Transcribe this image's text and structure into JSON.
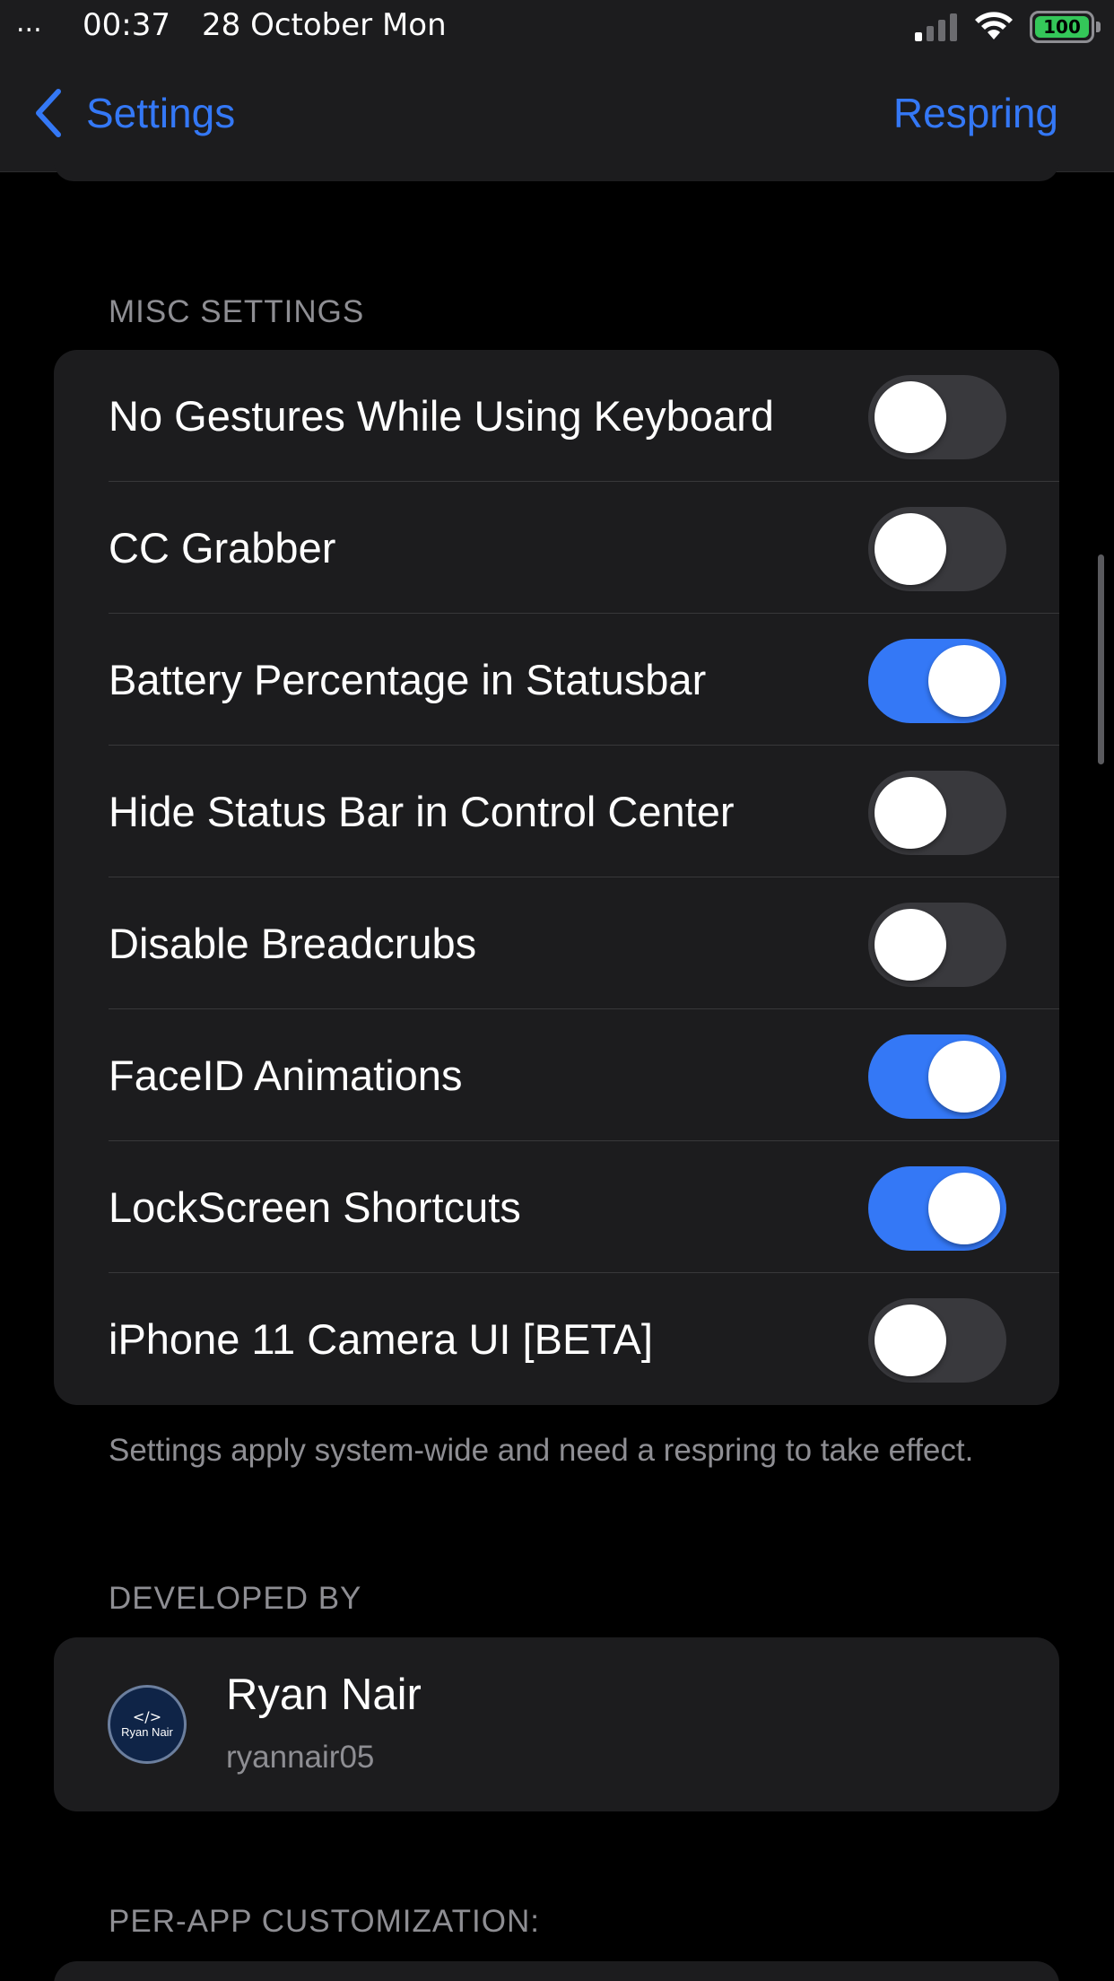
{
  "status_bar": {
    "dots": "...",
    "time": "00:37",
    "date": "28 October Mon",
    "battery": "100",
    "signal_icon": "cellular-signal-icon",
    "wifi_icon": "wifi-icon",
    "battery_icon": "battery-icon"
  },
  "nav": {
    "back_label": "Settings",
    "action_label": "Respring",
    "back_icon": "chevron-left-icon"
  },
  "sections": {
    "misc_header": "MISC SETTINGS",
    "developed_by_header": "DEVELOPED BY",
    "per_app_header": "PER-APP CUSTOMIZATION:"
  },
  "misc_settings": [
    {
      "label": "No Gestures While Using Keyboard",
      "on": false
    },
    {
      "label": "CC Grabber",
      "on": false
    },
    {
      "label": "Battery Percentage in Statusbar",
      "on": true
    },
    {
      "label": "Hide Status Bar in Control Center",
      "on": false
    },
    {
      "label": "Disable Breadcrubs",
      "on": false
    },
    {
      "label": "FaceID Animations",
      "on": true
    },
    {
      "label": "LockScreen Shortcuts",
      "on": true
    },
    {
      "label": "iPhone 11 Camera UI [BETA]",
      "on": false
    }
  ],
  "footer_note": "Settings apply system-wide and need a respring to take effect.",
  "developer": {
    "name": "Ryan Nair",
    "handle": "ryannair05",
    "avatar_code": "</>",
    "avatar_text": "Ryan Nair"
  },
  "colors": {
    "accent": "#3478f6",
    "background": "#000000",
    "card": "#1c1c1e",
    "toggle_off": "#39393d",
    "secondary_text": "#8e8e93"
  }
}
